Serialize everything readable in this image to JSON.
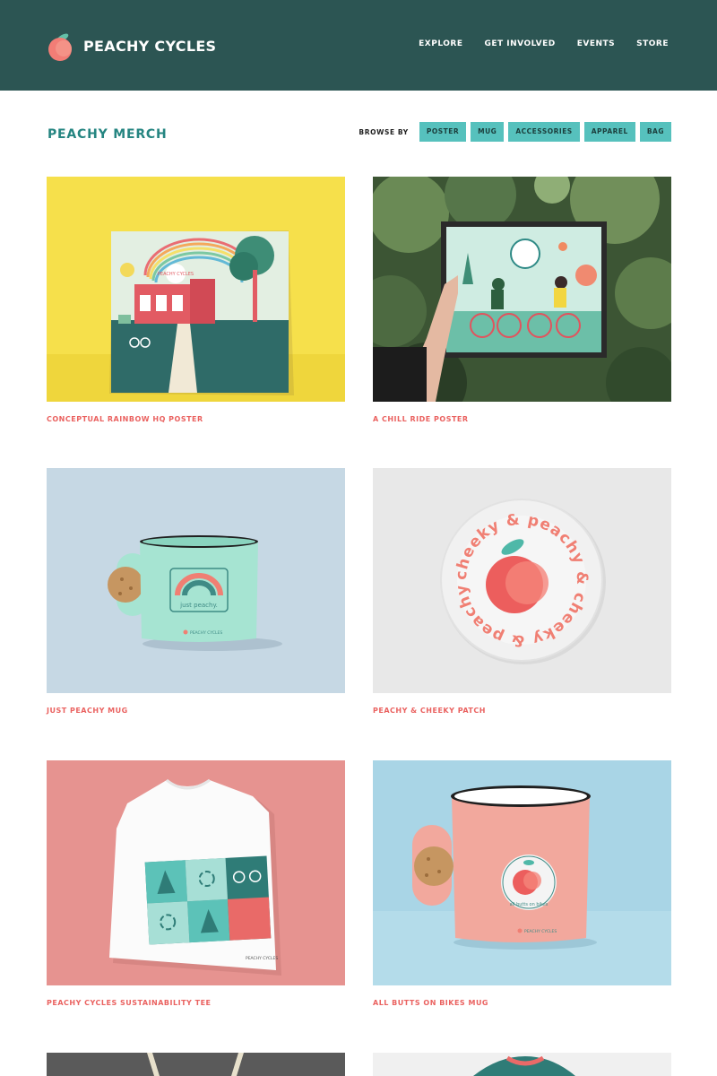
{
  "brand": {
    "name": "PEACHY CYCLES",
    "logo_icon": "peach-icon"
  },
  "nav": [
    "EXPLORE",
    "GET INVOLVED",
    "EVENTS",
    "STORE"
  ],
  "page": {
    "title": "PEACHY MERCH"
  },
  "browse": {
    "label": "BROWSE BY",
    "filters": [
      "POSTER",
      "MUG",
      "ACCESSORIES",
      "APPAREL",
      "BAG"
    ]
  },
  "products": [
    {
      "title": "CONCEPTUAL RAINBOW HQ POSTER"
    },
    {
      "title": "A CHILL RIDE POSTER"
    },
    {
      "title": "JUST PEACHY MUG",
      "mug_text": "just peachy.",
      "mug_brand": "PEACHY CYCLES"
    },
    {
      "title": "PEACHY & CHEEKY PATCH",
      "patch_text": "cheeky & peachy & cheeky & peachy & "
    },
    {
      "title": "PEACHY CYCLES SUSTAINABILITY TEE",
      "tee_brand": "PEACHY CYCLES"
    },
    {
      "title": "ALL BUTTS ON BIKES MUG",
      "mug_text": "all butts on bikes",
      "mug_brand": "PEACHY CYCLES"
    }
  ],
  "poster": {
    "sign": "PEACHY CYCLES"
  },
  "colors": {
    "header": "#2c5553",
    "title": "#258581",
    "pill": "#56c1bd",
    "caption": "#ea6260",
    "peach": "#f07f73",
    "mint": "#aeeadb"
  }
}
